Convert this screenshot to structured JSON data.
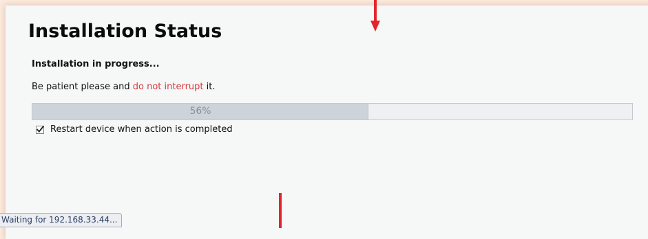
{
  "page": {
    "title": "Installation Status",
    "status_heading": "Installation in progress...",
    "patience": {
      "before": "Be patient please and ",
      "warning": "do not interrupt",
      "after": " it."
    }
  },
  "progress": {
    "percent": 56,
    "label": "56%"
  },
  "options": {
    "restart_checked": true,
    "restart_label": "Restart device when action is completed"
  },
  "status_bar": {
    "text": "Waiting for 192.168.33.44..."
  },
  "icons": {
    "checkbox": "checkmark-icon",
    "annotation_arrow": "down-arrow-icon"
  },
  "colors": {
    "page_background": "#fbe9dc",
    "panel_background": "#f6f7f7",
    "warning_text": "#d63a3a",
    "progress_fill": "#cdd3da",
    "progress_track": "#eef0f2",
    "annotation": "#e3242b"
  }
}
